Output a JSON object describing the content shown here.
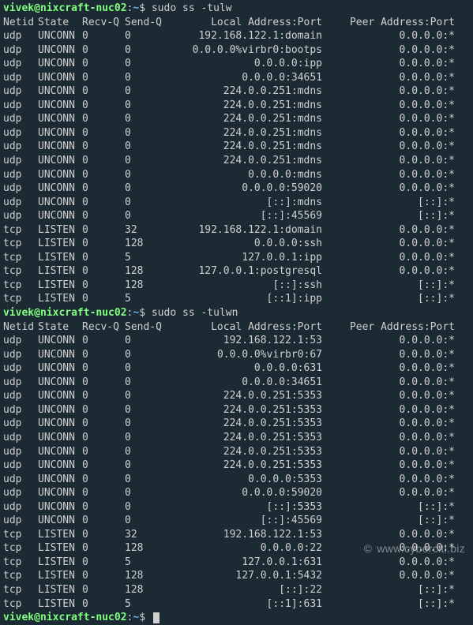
{
  "prompt": {
    "user": "vivek",
    "host": "nixcraft-nuc02",
    "path": "~",
    "sigil": "$"
  },
  "commands": {
    "cmd1": "sudo ss -tulw",
    "cmd2": "sudo ss -tulwn"
  },
  "headers": {
    "netid": "Netid",
    "state": "State",
    "recvq": "Recv-Q",
    "sendq": "Send-Q",
    "local": "Local Address:Port",
    "peer": "Peer Address:Port"
  },
  "table1": [
    {
      "netid": "udp",
      "state": "UNCONN",
      "recvq": "0",
      "sendq": "0",
      "local": "192.168.122.1:domain",
      "peer": "0.0.0.0:*"
    },
    {
      "netid": "udp",
      "state": "UNCONN",
      "recvq": "0",
      "sendq": "0",
      "local": "0.0.0.0%virbr0:bootps",
      "peer": "0.0.0.0:*"
    },
    {
      "netid": "udp",
      "state": "UNCONN",
      "recvq": "0",
      "sendq": "0",
      "local": "0.0.0.0:ipp",
      "peer": "0.0.0.0:*"
    },
    {
      "netid": "udp",
      "state": "UNCONN",
      "recvq": "0",
      "sendq": "0",
      "local": "0.0.0.0:34651",
      "peer": "0.0.0.0:*"
    },
    {
      "netid": "udp",
      "state": "UNCONN",
      "recvq": "0",
      "sendq": "0",
      "local": "224.0.0.251:mdns",
      "peer": "0.0.0.0:*"
    },
    {
      "netid": "udp",
      "state": "UNCONN",
      "recvq": "0",
      "sendq": "0",
      "local": "224.0.0.251:mdns",
      "peer": "0.0.0.0:*"
    },
    {
      "netid": "udp",
      "state": "UNCONN",
      "recvq": "0",
      "sendq": "0",
      "local": "224.0.0.251:mdns",
      "peer": "0.0.0.0:*"
    },
    {
      "netid": "udp",
      "state": "UNCONN",
      "recvq": "0",
      "sendq": "0",
      "local": "224.0.0.251:mdns",
      "peer": "0.0.0.0:*"
    },
    {
      "netid": "udp",
      "state": "UNCONN",
      "recvq": "0",
      "sendq": "0",
      "local": "224.0.0.251:mdns",
      "peer": "0.0.0.0:*"
    },
    {
      "netid": "udp",
      "state": "UNCONN",
      "recvq": "0",
      "sendq": "0",
      "local": "224.0.0.251:mdns",
      "peer": "0.0.0.0:*"
    },
    {
      "netid": "udp",
      "state": "UNCONN",
      "recvq": "0",
      "sendq": "0",
      "local": "0.0.0.0:mdns",
      "peer": "0.0.0.0:*"
    },
    {
      "netid": "udp",
      "state": "UNCONN",
      "recvq": "0",
      "sendq": "0",
      "local": "0.0.0.0:59020",
      "peer": "0.0.0.0:*"
    },
    {
      "netid": "udp",
      "state": "UNCONN",
      "recvq": "0",
      "sendq": "0",
      "local": "[::]:mdns",
      "peer": "[::]:*"
    },
    {
      "netid": "udp",
      "state": "UNCONN",
      "recvq": "0",
      "sendq": "0",
      "local": "[::]:45569",
      "peer": "[::]:*"
    },
    {
      "netid": "tcp",
      "state": "LISTEN",
      "recvq": "0",
      "sendq": "32",
      "local": "192.168.122.1:domain",
      "peer": "0.0.0.0:*"
    },
    {
      "netid": "tcp",
      "state": "LISTEN",
      "recvq": "0",
      "sendq": "128",
      "local": "0.0.0.0:ssh",
      "peer": "0.0.0.0:*"
    },
    {
      "netid": "tcp",
      "state": "LISTEN",
      "recvq": "0",
      "sendq": "5",
      "local": "127.0.0.1:ipp",
      "peer": "0.0.0.0:*"
    },
    {
      "netid": "tcp",
      "state": "LISTEN",
      "recvq": "0",
      "sendq": "128",
      "local": "127.0.0.1:postgresql",
      "peer": "0.0.0.0:*"
    },
    {
      "netid": "tcp",
      "state": "LISTEN",
      "recvq": "0",
      "sendq": "128",
      "local": "[::]:ssh",
      "peer": "[::]:*"
    },
    {
      "netid": "tcp",
      "state": "LISTEN",
      "recvq": "0",
      "sendq": "5",
      "local": "[::1]:ipp",
      "peer": "[::]:*"
    }
  ],
  "table2": [
    {
      "netid": "udp",
      "state": "UNCONN",
      "recvq": "0",
      "sendq": "0",
      "local": "192.168.122.1:53",
      "peer": "0.0.0.0:*"
    },
    {
      "netid": "udp",
      "state": "UNCONN",
      "recvq": "0",
      "sendq": "0",
      "local": "0.0.0.0%virbr0:67",
      "peer": "0.0.0.0:*"
    },
    {
      "netid": "udp",
      "state": "UNCONN",
      "recvq": "0",
      "sendq": "0",
      "local": "0.0.0.0:631",
      "peer": "0.0.0.0:*"
    },
    {
      "netid": "udp",
      "state": "UNCONN",
      "recvq": "0",
      "sendq": "0",
      "local": "0.0.0.0:34651",
      "peer": "0.0.0.0:*"
    },
    {
      "netid": "udp",
      "state": "UNCONN",
      "recvq": "0",
      "sendq": "0",
      "local": "224.0.0.251:5353",
      "peer": "0.0.0.0:*"
    },
    {
      "netid": "udp",
      "state": "UNCONN",
      "recvq": "0",
      "sendq": "0",
      "local": "224.0.0.251:5353",
      "peer": "0.0.0.0:*"
    },
    {
      "netid": "udp",
      "state": "UNCONN",
      "recvq": "0",
      "sendq": "0",
      "local": "224.0.0.251:5353",
      "peer": "0.0.0.0:*"
    },
    {
      "netid": "udp",
      "state": "UNCONN",
      "recvq": "0",
      "sendq": "0",
      "local": "224.0.0.251:5353",
      "peer": "0.0.0.0:*"
    },
    {
      "netid": "udp",
      "state": "UNCONN",
      "recvq": "0",
      "sendq": "0",
      "local": "224.0.0.251:5353",
      "peer": "0.0.0.0:*"
    },
    {
      "netid": "udp",
      "state": "UNCONN",
      "recvq": "0",
      "sendq": "0",
      "local": "224.0.0.251:5353",
      "peer": "0.0.0.0:*"
    },
    {
      "netid": "udp",
      "state": "UNCONN",
      "recvq": "0",
      "sendq": "0",
      "local": "0.0.0.0:5353",
      "peer": "0.0.0.0:*"
    },
    {
      "netid": "udp",
      "state": "UNCONN",
      "recvq": "0",
      "sendq": "0",
      "local": "0.0.0.0:59020",
      "peer": "0.0.0.0:*"
    },
    {
      "netid": "udp",
      "state": "UNCONN",
      "recvq": "0",
      "sendq": "0",
      "local": "[::]:5353",
      "peer": "[::]:*"
    },
    {
      "netid": "udp",
      "state": "UNCONN",
      "recvq": "0",
      "sendq": "0",
      "local": "[::]:45569",
      "peer": "[::]:*"
    },
    {
      "netid": "tcp",
      "state": "LISTEN",
      "recvq": "0",
      "sendq": "32",
      "local": "192.168.122.1:53",
      "peer": "0.0.0.0:*"
    },
    {
      "netid": "tcp",
      "state": "LISTEN",
      "recvq": "0",
      "sendq": "128",
      "local": "0.0.0.0:22",
      "peer": "0.0.0.0:*"
    },
    {
      "netid": "tcp",
      "state": "LISTEN",
      "recvq": "0",
      "sendq": "5",
      "local": "127.0.0.1:631",
      "peer": "0.0.0.0:*"
    },
    {
      "netid": "tcp",
      "state": "LISTEN",
      "recvq": "0",
      "sendq": "128",
      "local": "127.0.0.1:5432",
      "peer": "0.0.0.0:*"
    },
    {
      "netid": "tcp",
      "state": "LISTEN",
      "recvq": "0",
      "sendq": "128",
      "local": "[::]:22",
      "peer": "[::]:*"
    },
    {
      "netid": "tcp",
      "state": "LISTEN",
      "recvq": "0",
      "sendq": "5",
      "local": "[::1]:631",
      "peer": "[::]:*"
    }
  ],
  "watermark": {
    "copy": "©",
    "text": "www.cyberciti.biz"
  }
}
